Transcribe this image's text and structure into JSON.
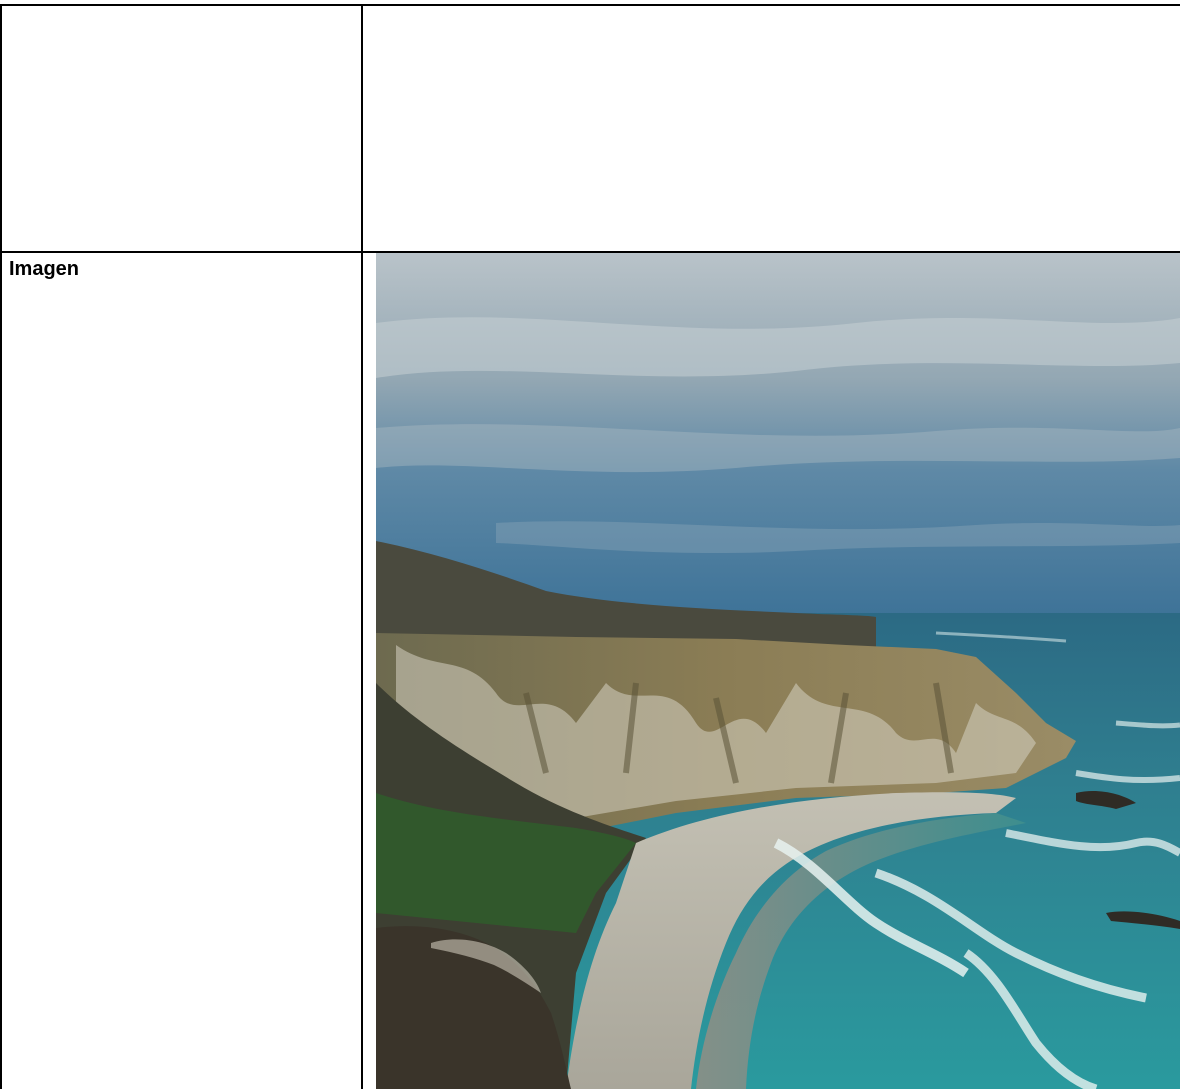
{
  "table": {
    "rows": [
      {
        "label": "",
        "content": ""
      },
      {
        "label": "Imagen",
        "content_type": "photo"
      }
    ]
  },
  "photo": {
    "subject": "coastal-cliffs-beach-photo",
    "colors": {
      "sky_top": "#b9c3c9",
      "sky_mid": "#7f97a6",
      "sky_low": "#3e7398",
      "sea_deep": "#2f6f86",
      "sea_shallow": "#2a9a9e",
      "foam": "#e8f2f0",
      "sand": "#b7b3a5",
      "cliff": "#8a7d57",
      "cliff_chalk": "#d6d2c2",
      "hill": "#4a4a3e",
      "vegetation": "#2f5d2c"
    }
  }
}
